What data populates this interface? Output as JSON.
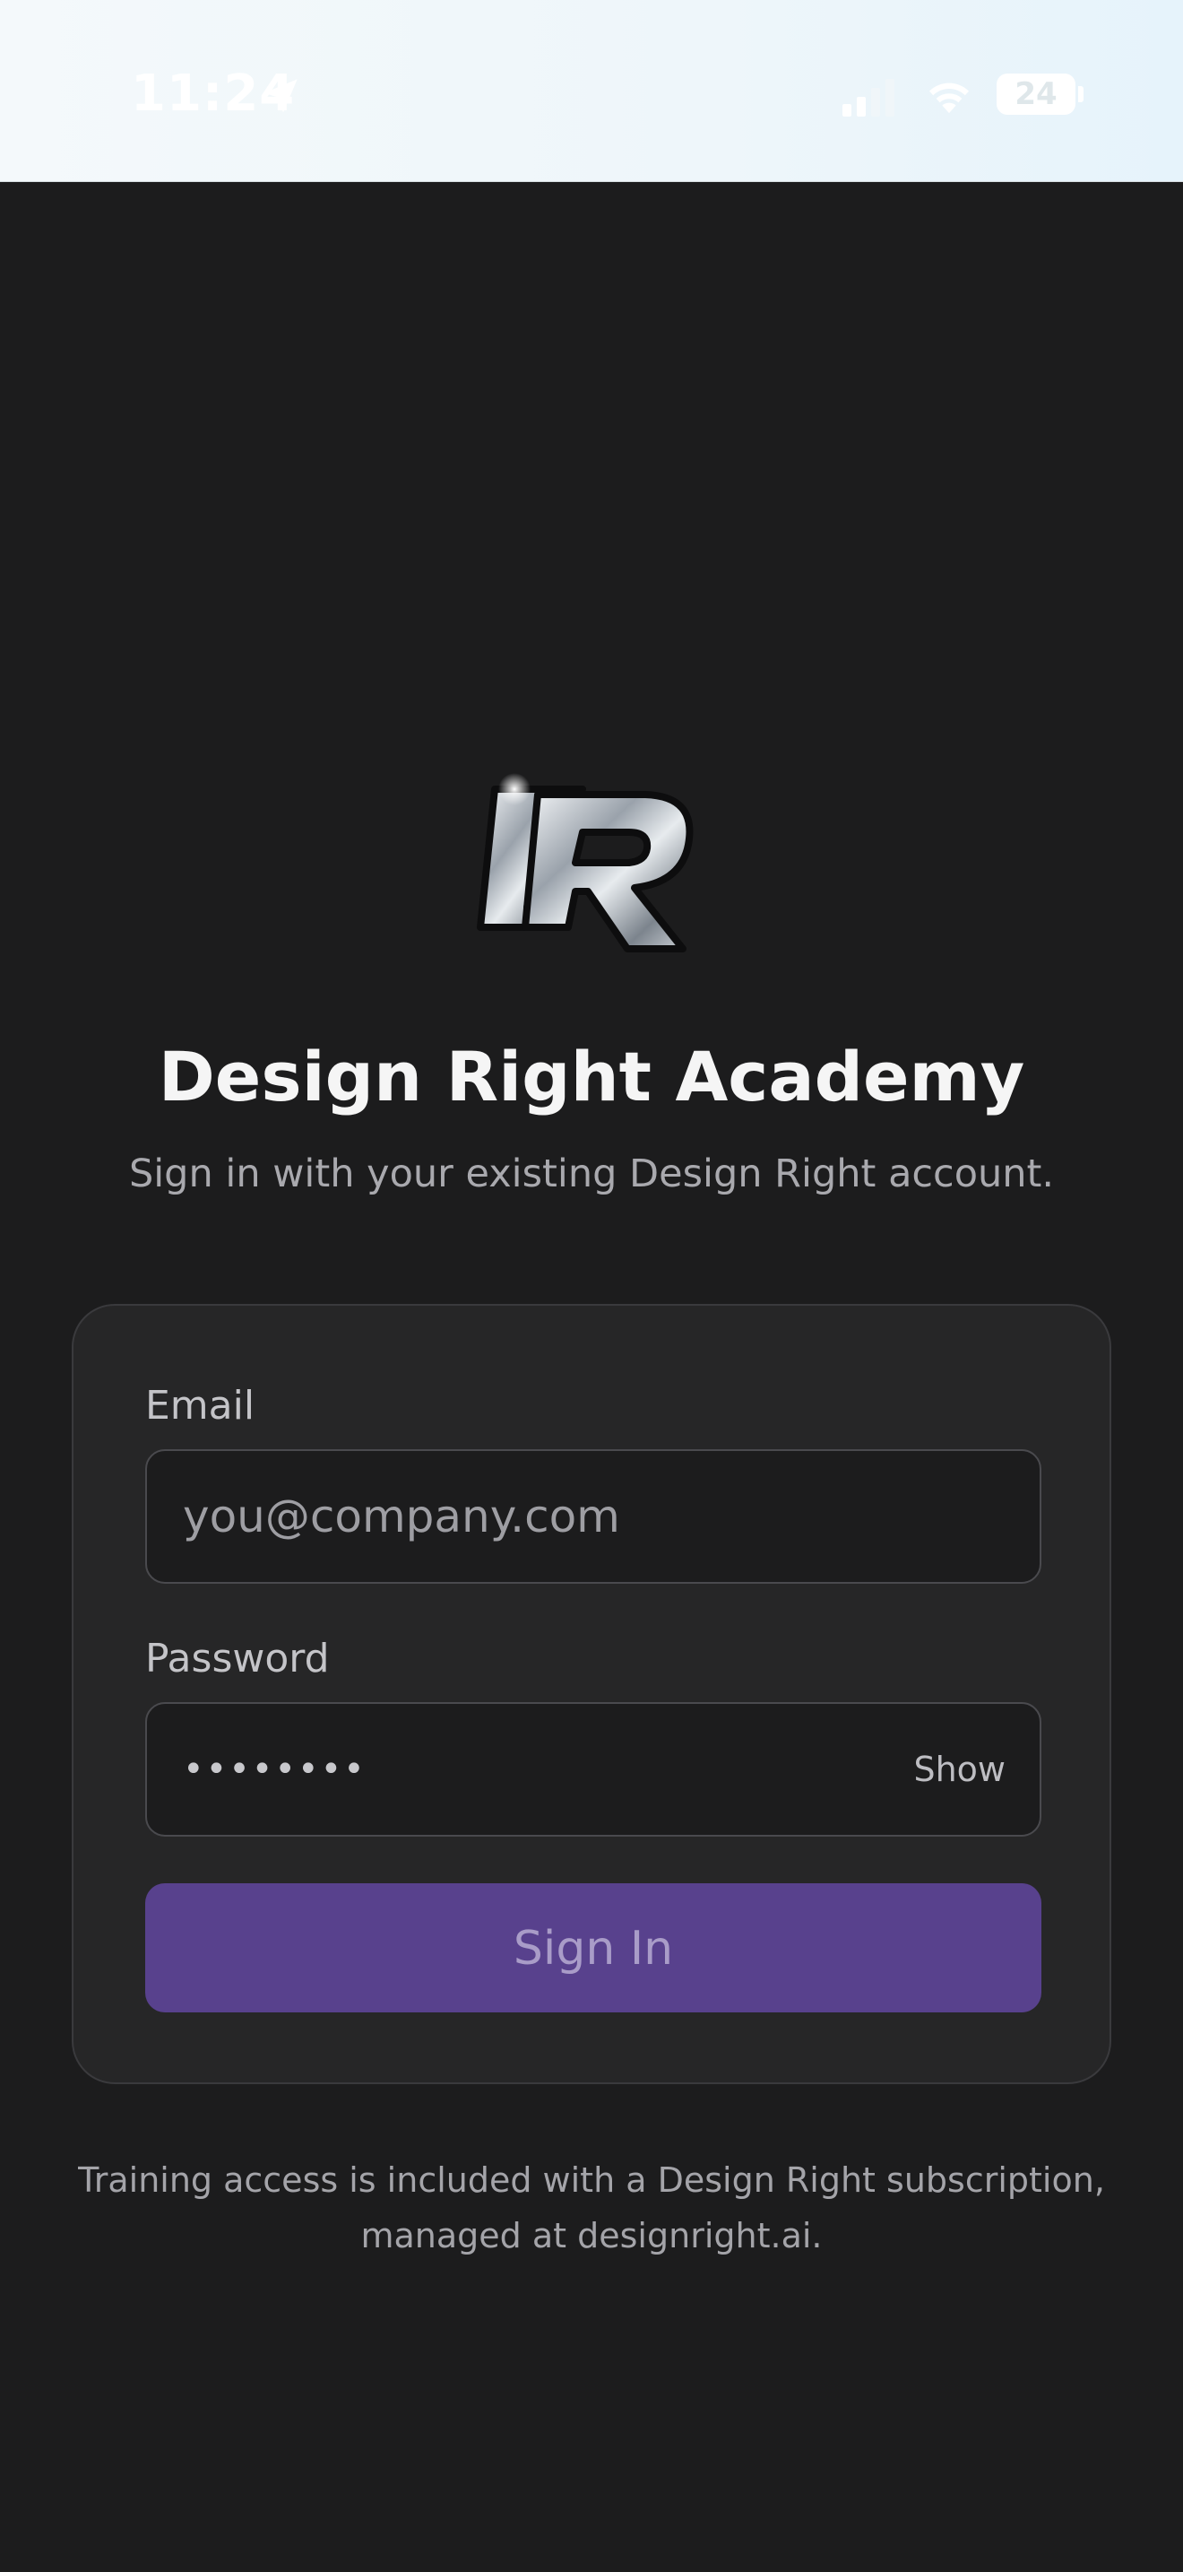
{
  "status_bar": {
    "time": "11:24",
    "battery_level": "24",
    "icons": [
      "location-arrow-icon",
      "cellular-signal-icon",
      "wifi-icon",
      "battery-icon"
    ]
  },
  "brand": {
    "logo": "design-right-logo",
    "title": "Design Right Academy",
    "subtitle": "Sign in with your existing Design Right account."
  },
  "form": {
    "email_label": "Email",
    "email_placeholder": "you@company.com",
    "password_label": "Password",
    "password_value": "••••••••",
    "show_label": "Show",
    "submit_label": "Sign In"
  },
  "footer": {
    "line1": "Training access is included with a Design Right subscription,",
    "line2": "managed at designright.ai."
  },
  "colors": {
    "background": "#1c1c1d",
    "card": "#262627",
    "accent": "#58418d"
  }
}
